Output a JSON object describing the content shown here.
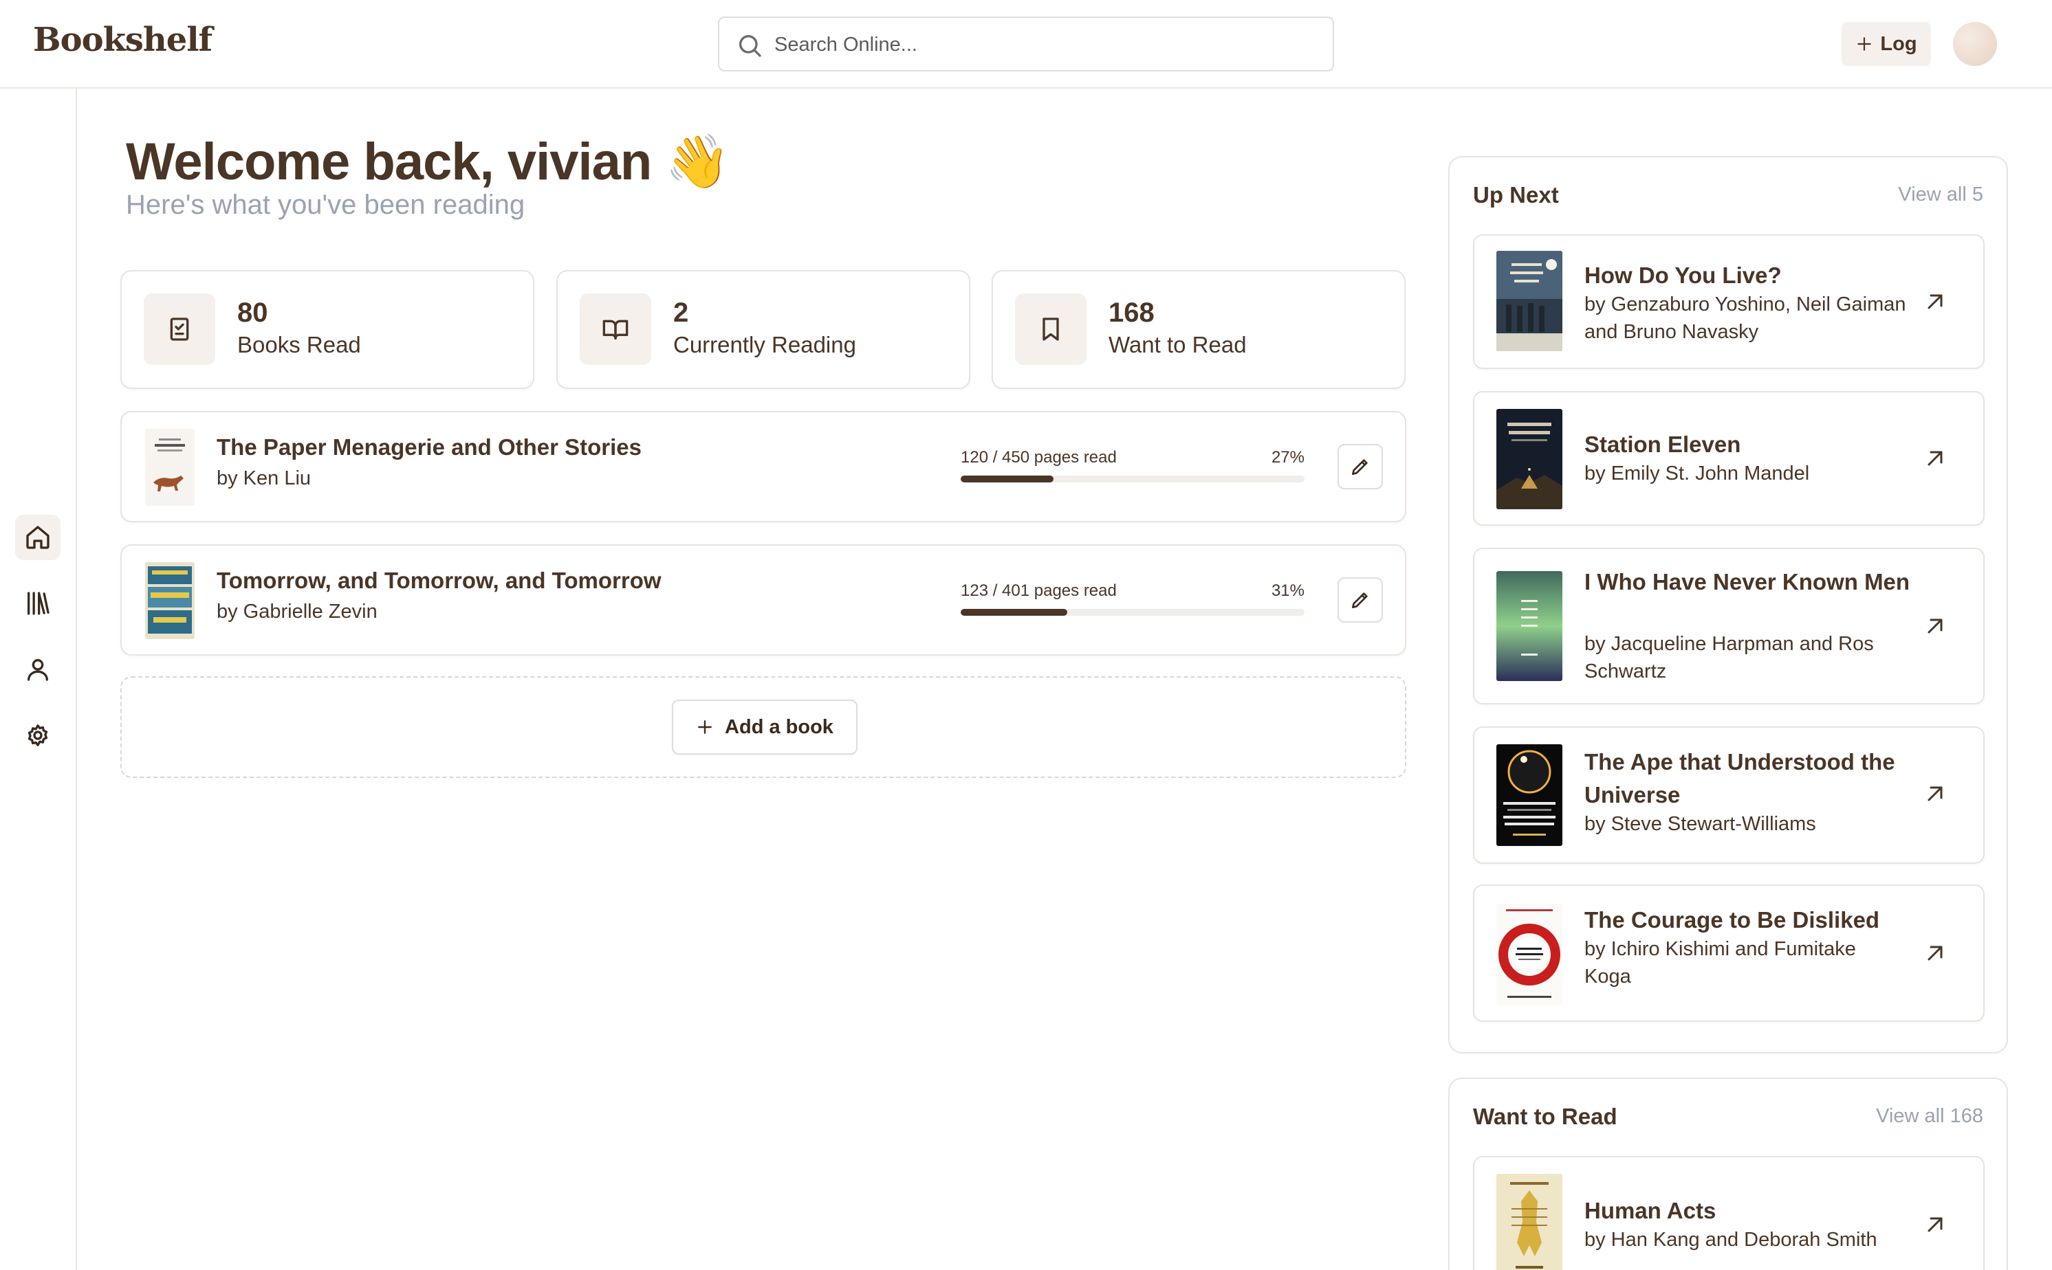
{
  "app": {
    "name": "Bookshelf"
  },
  "header": {
    "search_placeholder": "Search Online...",
    "log_label": "Log"
  },
  "sidebar": {
    "items": [
      {
        "icon": "home-icon",
        "active": true
      },
      {
        "icon": "library-icon",
        "active": false
      },
      {
        "icon": "user-icon",
        "active": false
      },
      {
        "icon": "gear-icon",
        "active": false
      }
    ]
  },
  "welcome": {
    "title": "Welcome back, vivian 👋",
    "subtitle": "Here's what you've been reading"
  },
  "stats": [
    {
      "icon": "checklist-icon",
      "value": "80",
      "label": "Books Read"
    },
    {
      "icon": "book-open-icon",
      "value": "2",
      "label": "Currently Reading"
    },
    {
      "icon": "bookmark-icon",
      "value": "168",
      "label": "Want to Read"
    }
  ],
  "currently_reading": [
    {
      "title": "The Paper Menagerie and Other Stories",
      "author": "by Ken Liu",
      "pages_text": "120 / 450 pages read",
      "percent_text": "27%",
      "progress": 0.27
    },
    {
      "title": "Tomorrow, and Tomorrow, and Tomorrow",
      "author": "by Gabrielle Zevin",
      "pages_text": "123 / 401 pages read",
      "percent_text": "31%",
      "progress": 0.31
    }
  ],
  "add_book_label": "Add a book",
  "up_next": {
    "heading": "Up Next",
    "view_all": "View all 5",
    "books": [
      {
        "title": "How Do You Live?",
        "author": "by Genzaburo Yoshino, Neil Gaiman and Bruno Navasky"
      },
      {
        "title": "Station Eleven",
        "author": "by Emily St. John Mandel"
      },
      {
        "title": "I Who Have Never Known Men",
        "author": "by Jacqueline Harpman and Ros Schwartz"
      },
      {
        "title": "The Ape that Understood the Universe",
        "author": "by Steve Stewart-Williams"
      },
      {
        "title": "The Courage to Be Disliked",
        "author": "by Ichiro Kishimi and Fumitake Koga"
      }
    ]
  },
  "want_to_read": {
    "heading": "Want to Read",
    "view_all": "View all 168",
    "books": [
      {
        "title": "Human Acts",
        "author": "by Han Kang and Deborah Smith"
      }
    ]
  }
}
